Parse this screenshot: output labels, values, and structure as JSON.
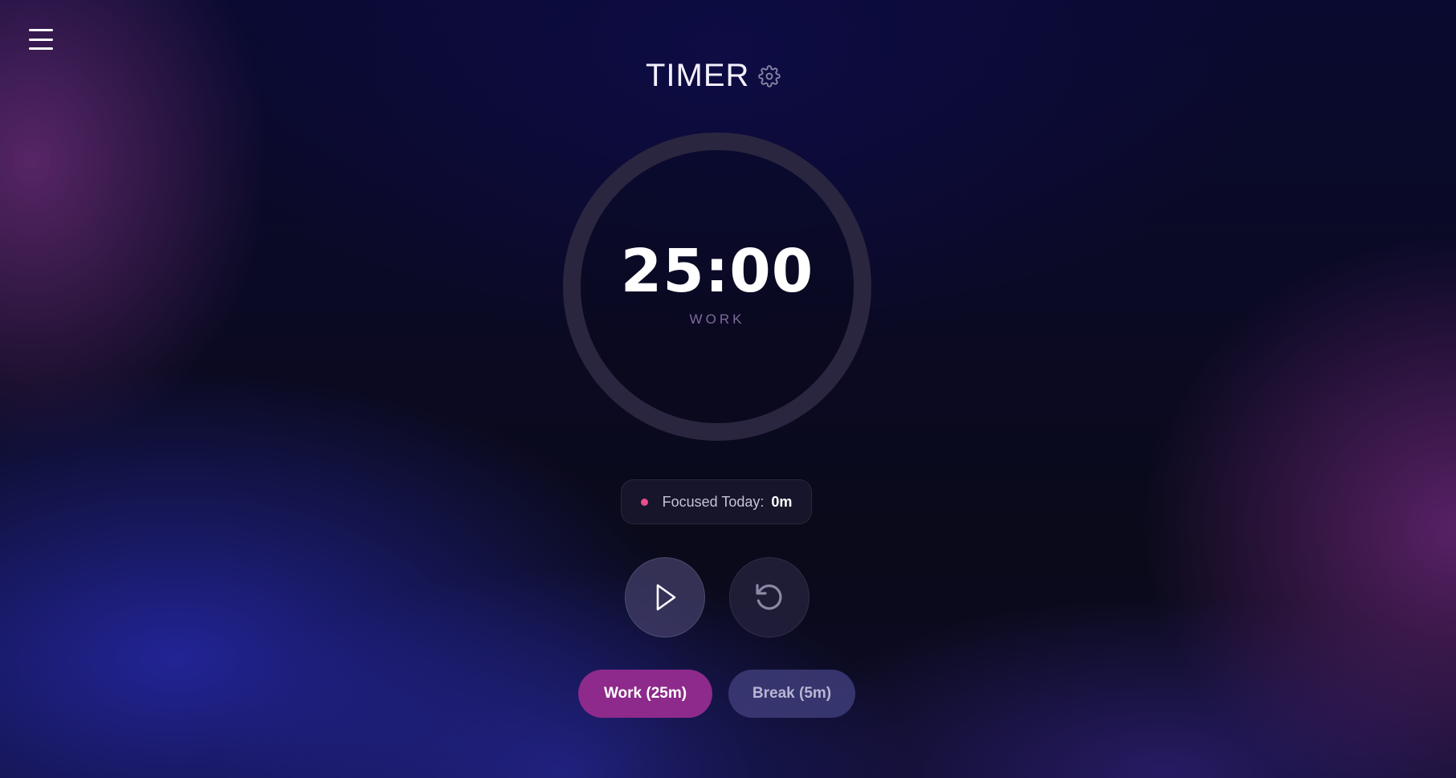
{
  "app": {
    "title": "TIMER"
  },
  "icons": {
    "menu": "hamburger-menu-icon",
    "settings": "gear-icon",
    "play": "play-icon",
    "reset": "reset-icon",
    "focus_dot": "status-dot"
  },
  "timer": {
    "time": "25:00",
    "mode": "WORK",
    "progress": 0
  },
  "stats": {
    "focused_label": "Focused Today:",
    "focused_value": "0m"
  },
  "modes": {
    "work_label": "Work (25m)",
    "break_label": "Break (5m)",
    "active": "work"
  },
  "colors": {
    "accent_work": "#8e2a8b",
    "break_button": "#3e3c78",
    "dot": "#ea4f8d",
    "ring_track": "#2a2640",
    "mode_text": "#7e6a9c"
  }
}
